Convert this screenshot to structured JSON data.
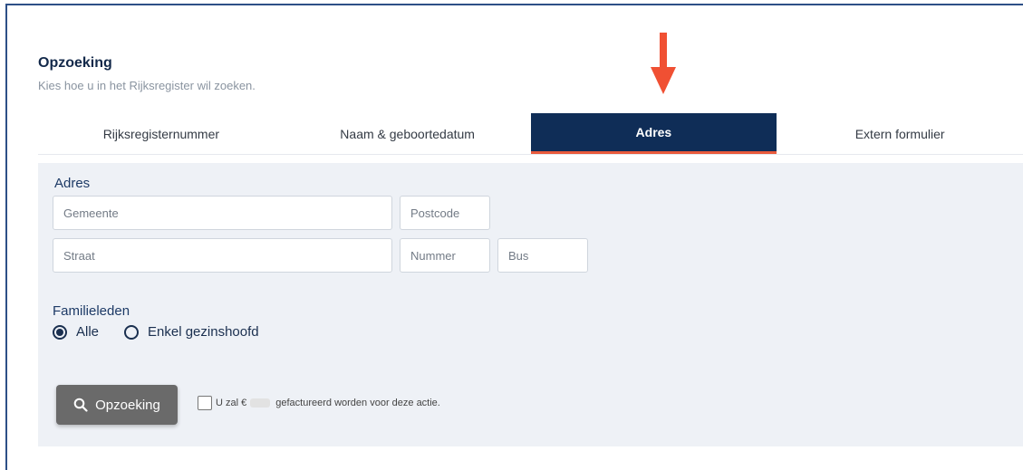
{
  "header": {
    "title": "Opzoeking",
    "subtitle": "Kies hoe u in het Rijksregister wil zoeken."
  },
  "tabs": [
    {
      "label": "Rijksregisternummer",
      "active": false
    },
    {
      "label": "Naam & geboortedatum",
      "active": false
    },
    {
      "label": "Adres",
      "active": true
    },
    {
      "label": "Extern formulier",
      "active": false
    }
  ],
  "address": {
    "section_label": "Adres",
    "gemeente_placeholder": "Gemeente",
    "postcode_placeholder": "Postcode",
    "straat_placeholder": "Straat",
    "nummer_placeholder": "Nummer",
    "bus_placeholder": "Bus"
  },
  "family": {
    "section_label": "Familieleden",
    "options": [
      {
        "label": "Alle",
        "selected": true
      },
      {
        "label": "Enkel gezinshoofd",
        "selected": false
      }
    ]
  },
  "actions": {
    "search_label": "Opzoeking",
    "billing_prefix": "U zal €",
    "billing_suffix": "gefactureerd worden voor deze actie."
  },
  "colors": {
    "active_tab": "#0f2d57",
    "tab_underline": "#e85a3c",
    "arrow": "#f05033",
    "panel": "#eef1f6"
  },
  "icons": {
    "search_button": "search-icon",
    "annotation": "arrow-down-icon"
  }
}
